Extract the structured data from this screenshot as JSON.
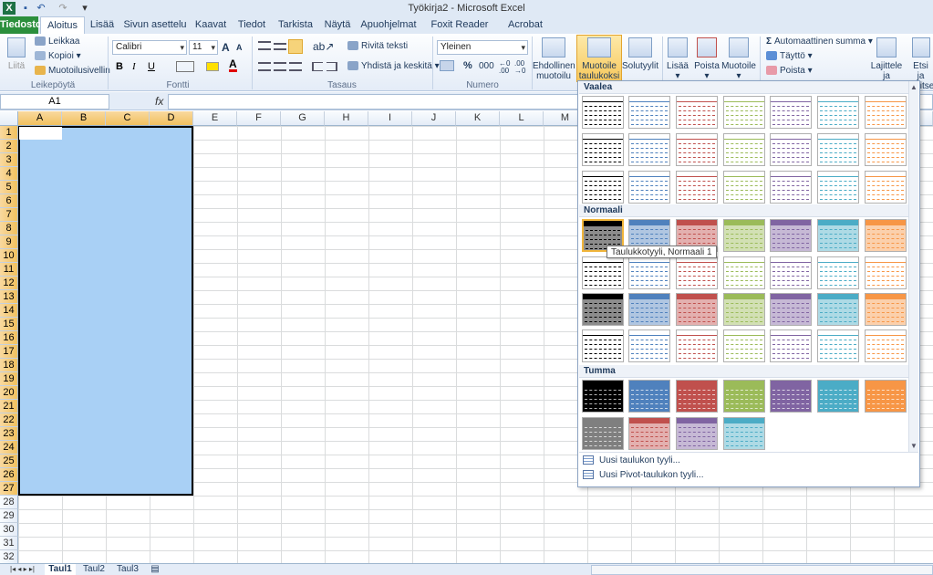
{
  "window": {
    "title": "Työkirja2 - Microsoft Excel"
  },
  "quick_access": {
    "icons": [
      "excel-logo-icon",
      "save-icon",
      "undo-icon",
      "redo-icon",
      "customize-icon"
    ]
  },
  "tabs": [
    "Tiedosto",
    "Aloitus",
    "Lisää",
    "Sivun asettelu",
    "Kaavat",
    "Tiedot",
    "Tarkista",
    "Näytä",
    "Apuohjelmat",
    "Foxit Reader PDF",
    "Acrobat"
  ],
  "active_tab": "Aloitus",
  "clipboard": {
    "paste": "Liitä",
    "cut": "Leikkaa",
    "copy": "Kopioi",
    "format_painter": "Muotoilusivellin",
    "group": "Leikepöytä"
  },
  "font": {
    "name": "Calibri",
    "size": "11",
    "bold": "B",
    "italic": "I",
    "underline": "U",
    "group": "Fontti",
    "grow": "A",
    "shrink": "A"
  },
  "alignment": {
    "wrap": "Rivitä teksti",
    "merge": "Yhdistä ja keskitä",
    "group": "Tasaus"
  },
  "number": {
    "format": "Yleinen",
    "percent": "%",
    "thousands": "000",
    "group": "Numero"
  },
  "styles": {
    "conditional": "Ehdollinen muotoilu",
    "format_table": "Muotoile taulukoksi",
    "cell_styles": "Solutyylit"
  },
  "cells": {
    "insert": "Lisää",
    "delete": "Poista",
    "format": "Muotoile"
  },
  "editing": {
    "autosum": "Automaattinen summa",
    "fill": "Täyttö",
    "clear": "Poista",
    "sort": "Lajittele ja suodata",
    "find": "Etsi ja valitse"
  },
  "formula_bar": {
    "name_box": "A1",
    "fx": "fx",
    "value": ""
  },
  "columns": [
    "A",
    "B",
    "C",
    "D",
    "E",
    "F",
    "G",
    "H",
    "I",
    "J",
    "K",
    "L",
    "M"
  ],
  "rows": [
    "1",
    "2",
    "3",
    "4",
    "5",
    "6",
    "7",
    "8",
    "9",
    "10",
    "11",
    "12",
    "13",
    "14",
    "15",
    "16",
    "17",
    "18",
    "19",
    "20",
    "21",
    "22",
    "23",
    "24",
    "25",
    "26",
    "27",
    "28",
    "29",
    "30",
    "31",
    "32"
  ],
  "selection": {
    "range": "A1:D27",
    "selected_columns": [
      "A",
      "B",
      "C",
      "D"
    ],
    "rows_selected": 27
  },
  "sheets": [
    "Taul1",
    "Taul2",
    "Taul3"
  ],
  "active_sheet": "Taul1",
  "gallery": {
    "sections": [
      "Vaalea",
      "Normaali",
      "Tumma"
    ],
    "colors": [
      "#000000",
      "#4f81bd",
      "#c0504d",
      "#9bbb59",
      "#8064a2",
      "#4bacc6",
      "#f79646"
    ],
    "tooltip": "Taulukkotyyli, Normaali 1",
    "footer": [
      "Uusi taulukon tyyli...",
      "Uusi Pivot-taulukon tyyli..."
    ]
  }
}
